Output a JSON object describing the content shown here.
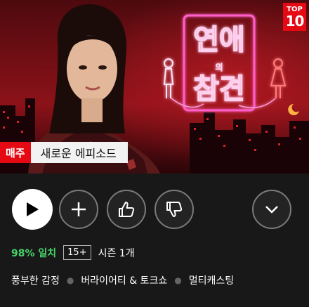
{
  "hero": {
    "top_badge_line1": "TOP",
    "top_badge_line2": "10",
    "weekly_label": "매주",
    "new_episode_label": "새로운 에피소드",
    "neon_sign_text": "연애의 참견"
  },
  "controls": {
    "play": "play-icon",
    "add": "plus-icon",
    "like": "thumbs-up-icon",
    "dislike": "thumbs-down-icon",
    "more": "chevron-down-icon"
  },
  "meta": {
    "match": "98% 일치",
    "rating": "15+",
    "season": "시즌 1개"
  },
  "genres": [
    "풍부한 감정",
    "버라이어티 & 토크쇼",
    "멀티캐스팅"
  ],
  "colors": {
    "accent_red": "#e50914",
    "match_green": "#46d369",
    "neon_pink": "#ff5fc8"
  }
}
